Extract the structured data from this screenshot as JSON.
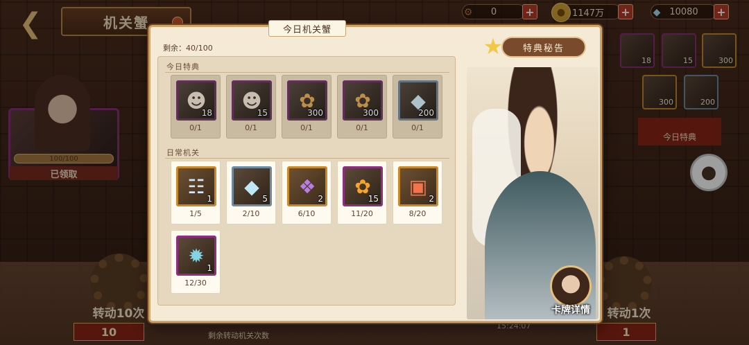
{
  "header": {
    "back_icon": "back-arrow-icon",
    "title": "机关蟹",
    "resources": [
      {
        "icon": "gear-icon",
        "value": "0"
      },
      {
        "icon": "coin-icon",
        "value": "1147万"
      },
      {
        "icon": "crystal-icon",
        "value": "10080"
      }
    ]
  },
  "left_card": {
    "progress": "100/100",
    "status": "已领取"
  },
  "modal": {
    "tab_title": "今日机关蟹",
    "remaining": "剩余：40/100",
    "section_today": "今日特典",
    "section_daily": "日常机关",
    "today_items": [
      {
        "icon": "character-card-icon",
        "qty": "18",
        "progress": "0/1"
      },
      {
        "icon": "character-card-icon",
        "qty": "15",
        "progress": "0/1"
      },
      {
        "icon": "gold-bulb-icon",
        "qty": "300",
        "progress": "0/1"
      },
      {
        "icon": "gold-bulb-icon",
        "qty": "300",
        "progress": "0/1"
      },
      {
        "icon": "crystal-icon",
        "qty": "200",
        "progress": "0/1"
      }
    ],
    "daily_items": [
      {
        "icon": "scroll-ticket-icon",
        "qty": "1",
        "progress": "1/5"
      },
      {
        "icon": "crystal-icon",
        "qty": "5",
        "progress": "2/10"
      },
      {
        "icon": "purple-gem-icon",
        "qty": "2",
        "progress": "6/10"
      },
      {
        "icon": "gold-bulb-icon",
        "qty": "15",
        "progress": "11/20"
      },
      {
        "icon": "gift-box-icon",
        "qty": "2",
        "progress": "8/20"
      },
      {
        "icon": "swirl-shard-icon",
        "qty": "1",
        "progress": "12/30"
      }
    ],
    "bonus_header": "特典秘告",
    "card_detail": "卡牌详情"
  },
  "right_panel": {
    "items": [
      {
        "icon": "character-card-icon",
        "qty": "18"
      },
      {
        "icon": "character-card-icon",
        "qty": "15"
      },
      {
        "icon": "gold-bulb-icon",
        "qty": "300"
      },
      {
        "icon": "gold-bulb-icon",
        "qty": "300"
      },
      {
        "icon": "crystal-icon",
        "qty": "200"
      }
    ],
    "banner": "今日特典"
  },
  "bottom": {
    "spin10_label": "转动10次",
    "spin10_count": "10",
    "spin1_label": "转动1次",
    "spin1_count": "1",
    "hint": "剩余转动机关次数",
    "timer": "15:24:07"
  },
  "colors": {
    "modal_bg": "#f4ead6",
    "frame_gold": "#cfa468",
    "rare_purple": "#8b2f7e",
    "rare_gold": "#c8892b"
  }
}
